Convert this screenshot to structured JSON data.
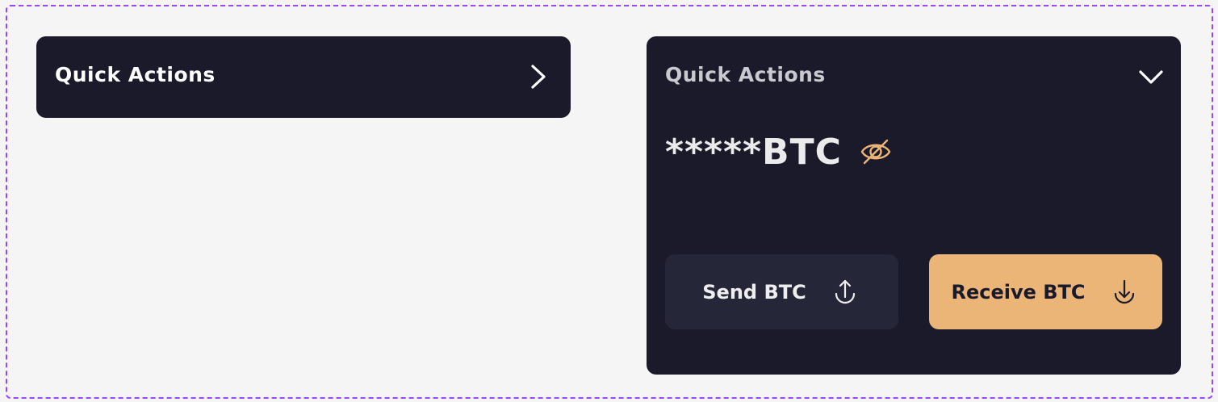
{
  "collapsed_card": {
    "title": "Quick Actions",
    "toggle_icon": "chevron-right-icon"
  },
  "expanded_card": {
    "title": "Quick Actions",
    "toggle_icon": "chevron-down-icon",
    "balance": "*****BTC",
    "visibility_icon": "eye-off-icon",
    "send_button": {
      "label": "Send BTC",
      "icon": "upload-arrow-icon"
    },
    "receive_button": {
      "label": "Receive BTC",
      "icon": "download-arrow-icon"
    }
  },
  "colors": {
    "page_bg": "#f5f5f5",
    "frame_border": "#9747ff",
    "card_bg": "#1a1a2b",
    "send_bg": "#262639",
    "accent": "#ebb577"
  }
}
